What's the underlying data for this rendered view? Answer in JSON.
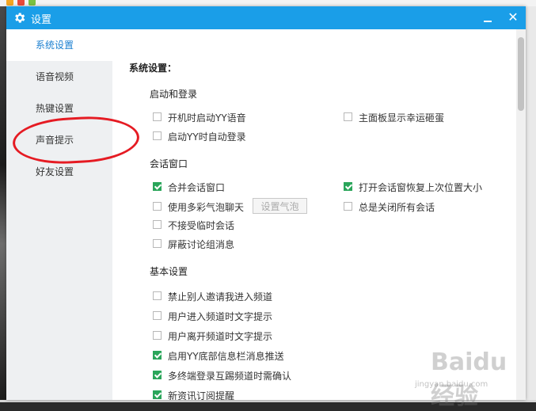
{
  "window": {
    "title": "设置",
    "close_label": "✕"
  },
  "sidebar": {
    "items": [
      {
        "label": "系统设置",
        "active": true
      },
      {
        "label": "语音视频",
        "active": false
      },
      {
        "label": "热键设置",
        "active": false
      },
      {
        "label": "声音提示",
        "active": false
      },
      {
        "label": "好友设置",
        "active": false
      }
    ]
  },
  "content": {
    "section_title": "系统设置：",
    "groups": {
      "startup": {
        "title": "启动和登录",
        "options": [
          {
            "label": "开机时启动YY语音",
            "checked": false
          },
          {
            "label": "主面板显示幸运砸蛋",
            "checked": false
          },
          {
            "label": "启动YY时自动登录",
            "checked": false
          }
        ]
      },
      "chat": {
        "title": "会话窗口",
        "options": [
          {
            "label": "合并会话窗口",
            "checked": true
          },
          {
            "label": "打开会话窗恢复上次位置大小",
            "checked": true
          },
          {
            "label": "使用多彩气泡聊天",
            "checked": false
          },
          {
            "label": "总是关闭所有会话",
            "checked": false
          },
          {
            "label": "不接受临时会话",
            "checked": false
          },
          {
            "label": "屏蔽讨论组消息",
            "checked": false
          }
        ],
        "bubble_button": "设置气泡"
      },
      "basic": {
        "title": "基本设置",
        "options": [
          {
            "label": "禁止别人邀请我进入频道",
            "checked": false
          },
          {
            "label": "用户进入频道时文字提示",
            "checked": false
          },
          {
            "label": "用户离开频道时文字提示",
            "checked": false
          },
          {
            "label": "启用YY底部信息栏消息推送",
            "checked": true
          },
          {
            "label": "多终端登录互踢频道时需确认",
            "checked": true
          },
          {
            "label": "新资讯订阅提醒",
            "checked": true
          }
        ]
      }
    }
  },
  "watermark": {
    "title": "Baidu 经验",
    "subtitle": "jingyan.baidu.com"
  },
  "colors": {
    "titlebar": "#1a9ee8",
    "checked": "#2aa55a",
    "annotation": "#e51b23",
    "active_nav": "#1a7fd0"
  },
  "icons": {
    "title": "gear-icon",
    "minimize": "minimize-icon",
    "close": "close-icon"
  }
}
